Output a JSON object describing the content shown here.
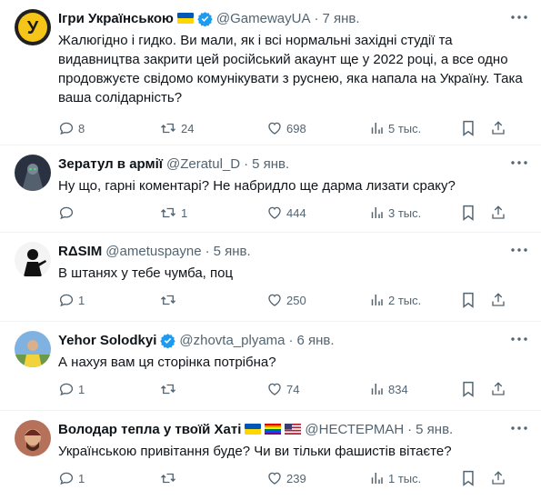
{
  "tweets": [
    {
      "name": "Ігри Українською",
      "handle": "@GamewayUA",
      "time": "7 янв.",
      "text": "Жалюгідно і гидко. Ви мали, як і всі нормальні західні студії та видавництва закрити цей російський акаунт ще у 2022 році, а все одно продовжуєте свідомо комунікувати з руснею, яка напала на Україну. Така ваша солідарність?",
      "replies": "8",
      "retweets": "24",
      "likes": "698",
      "views": "5 тыс.",
      "avatar_letter": "У"
    },
    {
      "name": "Зератул в армії",
      "handle": "@Zeratul_D",
      "time": "5 янв.",
      "text": "Ну що, гарні коментарі? Не набридло ще дарма лизати сраку?",
      "replies": "",
      "retweets": "1",
      "likes": "444",
      "views": "3 тыс."
    },
    {
      "name": "RΔSIM",
      "handle": "@ametuspayne",
      "time": "5 янв.",
      "text": "В штанях у тебе чумба, поц",
      "replies": "1",
      "retweets": "",
      "likes": "250",
      "views": "2 тыс."
    },
    {
      "name": "Yehor Solodkyi",
      "handle": "@zhovta_plyama",
      "time": "6 янв.",
      "text": "А нахуя вам ця сторінка потрібна?",
      "replies": "1",
      "retweets": "",
      "likes": "74",
      "views": "834"
    },
    {
      "name": "Володар тепла у твоїй Хаті",
      "handle": "@НЕСТЕРМАН",
      "time": "5 янв.",
      "text": "Українською привітання буде? Чи ви тільки фашистів вітаєте?",
      "replies": "1",
      "retweets": "",
      "likes": "239",
      "views": "1 тыс."
    }
  ],
  "colors": {
    "verified": "#1d9bf0",
    "text": "#0f1419",
    "muted": "#536471",
    "separator": "#eff3f4"
  }
}
